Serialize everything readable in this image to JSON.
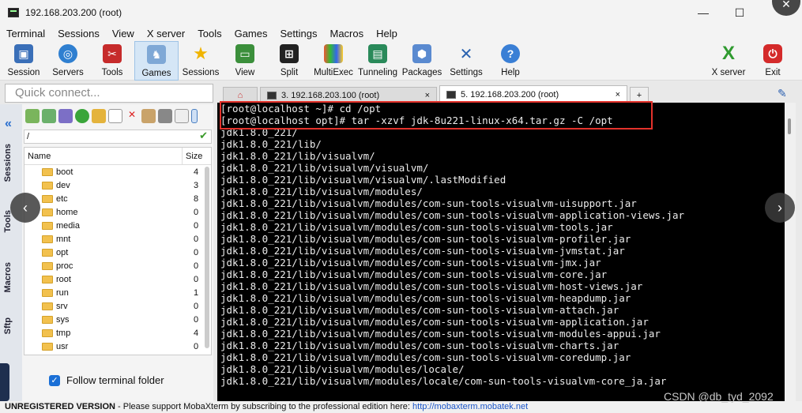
{
  "window": {
    "title": "192.168.203.200 (root)"
  },
  "menu": [
    "Terminal",
    "Sessions",
    "View",
    "X server",
    "Tools",
    "Games",
    "Settings",
    "Macros",
    "Help"
  ],
  "toolbar": {
    "session": "Session",
    "servers": "Servers",
    "tools": "Tools",
    "games": "Games",
    "sessions": "Sessions",
    "view": "View",
    "split": "Split",
    "multiexec": "MultiExec",
    "tunneling": "Tunneling",
    "packages": "Packages",
    "settings": "Settings",
    "help": "Help",
    "xserver": "X server",
    "exit": "Exit"
  },
  "quick_connect": {
    "placeholder": "Quick connect..."
  },
  "tabs": {
    "tab3": "3. 192.168.203.100 (root)",
    "tab5": "5. 192.168.203.200 (root)",
    "close": "×"
  },
  "side": {
    "sessions": "Sessions",
    "tools": "Tools",
    "macros": "Macros",
    "sftp": "Sftp"
  },
  "sftp": {
    "path": "/",
    "col_name": "Name",
    "col_size": "Size",
    "files": [
      {
        "name": "boot",
        "size": "4"
      },
      {
        "name": "dev",
        "size": "3"
      },
      {
        "name": "etc",
        "size": "8"
      },
      {
        "name": "home",
        "size": "0"
      },
      {
        "name": "media",
        "size": "0"
      },
      {
        "name": "mnt",
        "size": "0"
      },
      {
        "name": "opt",
        "size": "0"
      },
      {
        "name": "proc",
        "size": "0"
      },
      {
        "name": "root",
        "size": "0"
      },
      {
        "name": "run",
        "size": "1"
      },
      {
        "name": "srv",
        "size": "0"
      },
      {
        "name": "sys",
        "size": "0"
      },
      {
        "name": "tmp",
        "size": "4"
      },
      {
        "name": "usr",
        "size": "0"
      }
    ],
    "follow_label": "Follow terminal folder"
  },
  "terminal": {
    "lines": [
      "[root@localhost ~]# cd /opt",
      "[root@localhost opt]# tar -xzvf jdk-8u221-linux-x64.tar.gz -C /opt",
      "jdk1.8.0_221/",
      "jdk1.8.0_221/lib/",
      "jdk1.8.0_221/lib/visualvm/",
      "jdk1.8.0_221/lib/visualvm/visualvm/",
      "jdk1.8.0_221/lib/visualvm/visualvm/.lastModified",
      "jdk1.8.0_221/lib/visualvm/modules/",
      "jdk1.8.0_221/lib/visualvm/modules/com-sun-tools-visualvm-uisupport.jar",
      "jdk1.8.0_221/lib/visualvm/modules/com-sun-tools-visualvm-application-views.jar",
      "jdk1.8.0_221/lib/visualvm/modules/com-sun-tools-visualvm-tools.jar",
      "jdk1.8.0_221/lib/visualvm/modules/com-sun-tools-visualvm-profiler.jar",
      "jdk1.8.0_221/lib/visualvm/modules/com-sun-tools-visualvm-jvmstat.jar",
      "jdk1.8.0_221/lib/visualvm/modules/com-sun-tools-visualvm-jmx.jar",
      "jdk1.8.0_221/lib/visualvm/modules/com-sun-tools-visualvm-core.jar",
      "jdk1.8.0_221/lib/visualvm/modules/com-sun-tools-visualvm-host-views.jar",
      "jdk1.8.0_221/lib/visualvm/modules/com-sun-tools-visualvm-heapdump.jar",
      "jdk1.8.0_221/lib/visualvm/modules/com-sun-tools-visualvm-attach.jar",
      "jdk1.8.0_221/lib/visualvm/modules/com-sun-tools-visualvm-application.jar",
      "jdk1.8.0_221/lib/visualvm/modules/com-sun-tools-visualvm-modules-appui.jar",
      "jdk1.8.0_221/lib/visualvm/modules/com-sun-tools-visualvm-charts.jar",
      "jdk1.8.0_221/lib/visualvm/modules/com-sun-tools-visualvm-coredump.jar",
      "jdk1.8.0_221/lib/visualvm/modules/locale/",
      "jdk1.8.0_221/lib/visualvm/modules/locale/com-sun-tools-visualvm-core_ja.jar"
    ]
  },
  "status": {
    "unregistered": "UNREGISTERED VERSION",
    "message": " -  Please support MobaXterm by subscribing to the professional edition here: ",
    "link": "http://mobaxterm.mobatek.net"
  },
  "watermark": "CSDN @db_tyd_2092"
}
